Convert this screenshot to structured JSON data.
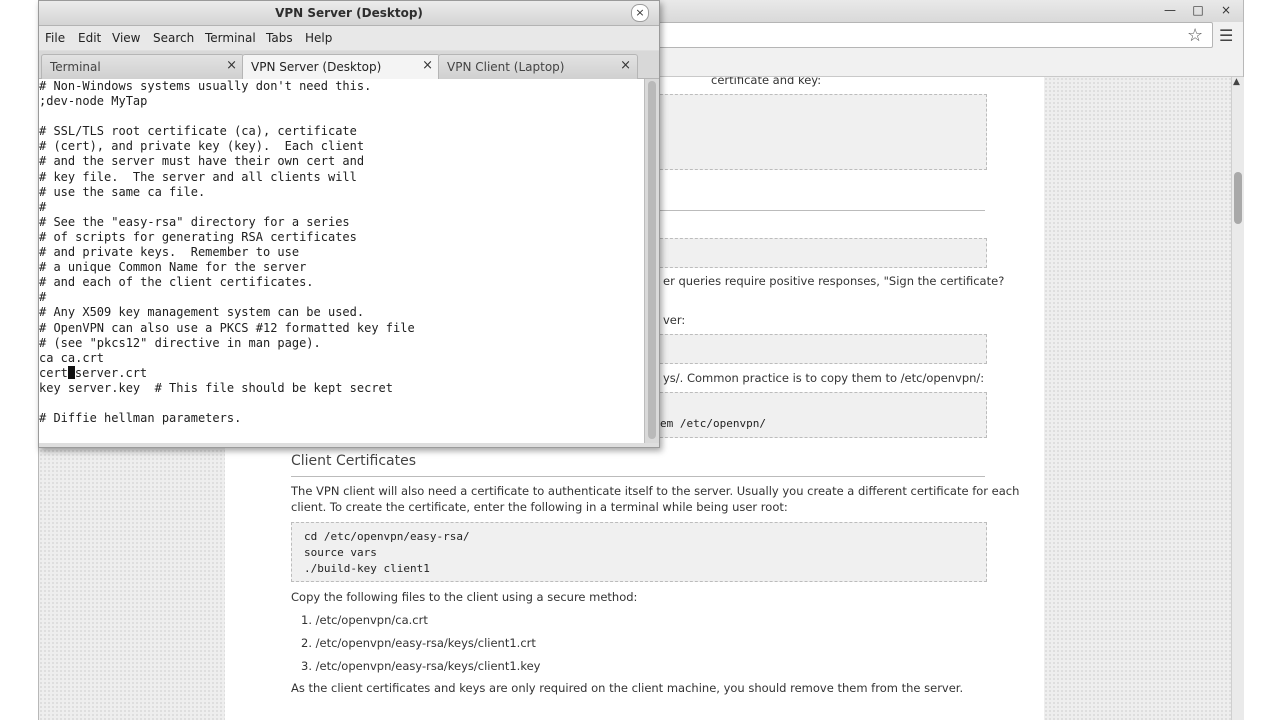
{
  "browser": {
    "tab_title": "",
    "window_controls": [
      "×",
      "—",
      "–",
      "×"
    ],
    "doc": {
      "partial_line_1": "certificate and key:",
      "partial_line_2": "er queries require positive responses, \"Sign the certificate?",
      "partial_line_3": "ver:",
      "partial_line_4": "ys/. Common practice is to copy them to /etc/openvpn/:",
      "partial_code_1": "em /etc/openvpn/",
      "section_heading": "Client Certificates",
      "para_1_line_1": "The VPN client will also need a certificate to authenticate itself to the server. Usually you create a different certificate for each",
      "para_1_line_2": "client. To create the certificate, enter the following in a terminal while being user root:",
      "code_lines": [
        "cd /etc/openvpn/easy-rsa/",
        "source vars",
        "./build-key client1"
      ],
      "para_2": "Copy the following files to the client using a secure method:",
      "list_items": [
        "1.  /etc/openvpn/ca.crt",
        "2.  /etc/openvpn/easy-rsa/keys/client1.crt",
        "3.  /etc/openvpn/easy-rsa/keys/client1.key"
      ],
      "para_3": "As the client certificates and keys are only required on the client machine, you should remove them from the server."
    }
  },
  "terminal": {
    "title": "VPN Server (Desktop)",
    "close_glyph": "×",
    "menu": [
      "File",
      "Edit",
      "View",
      "Search",
      "Terminal",
      "Tabs",
      "Help"
    ],
    "tabs": [
      {
        "label": "Terminal",
        "close": "×",
        "active": false
      },
      {
        "label": "VPN Server (Desktop)",
        "close": "×",
        "active": true
      },
      {
        "label": "VPN Client (Laptop)",
        "close": "×",
        "active": false
      }
    ],
    "lines": [
      "# Non-Windows systems usually don't need this.",
      ";dev-node MyTap",
      "",
      "# SSL/TLS root certificate (ca), certificate",
      "# (cert), and private key (key).  Each client",
      "# and the server must have their own cert and",
      "# key file.  The server and all clients will",
      "# use the same ca file.",
      "#",
      "# See the \"easy-rsa\" directory for a series",
      "# of scripts for generating RSA certificates",
      "# and private keys.  Remember to use",
      "# a unique Common Name for the server",
      "# and each of the client certificates.",
      "#",
      "# Any X509 key management system can be used.",
      "# OpenVPN can also use a PKCS #12 formatted key file",
      "# (see \"pkcs12\" directive in man page).",
      "ca ca.crt",
      "CURSOR_LINE",
      "key server.key  # This file should be kept secret",
      "",
      "# Diffie hellman parameters."
    ],
    "cursor_line_before": "cert",
    "cursor_line_after": "server.crt"
  }
}
